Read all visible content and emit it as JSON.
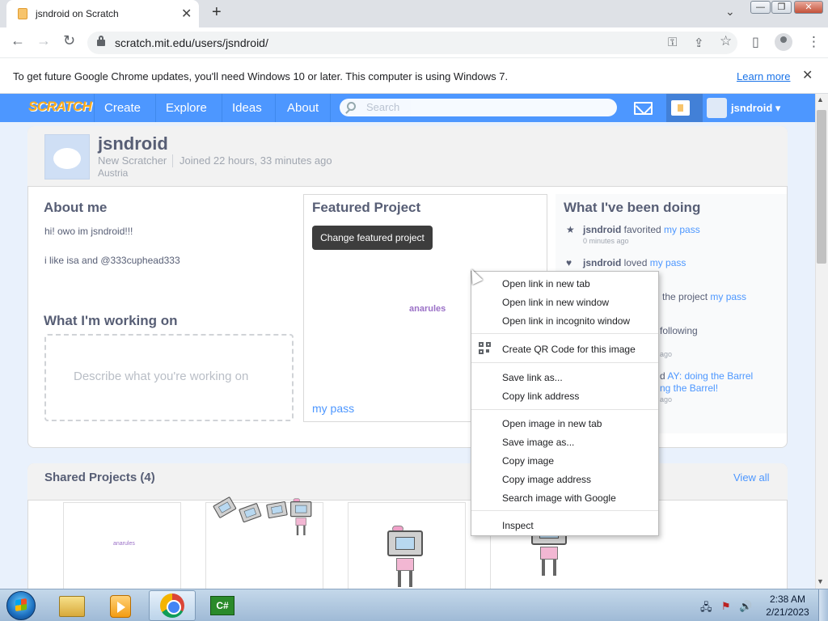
{
  "browser": {
    "tab_title": "jsndroid on Scratch",
    "tab_close": "✕",
    "new_tab": "+",
    "tab_search": "⌄",
    "url": "scratch.mit.edu/users/jsndroid/",
    "window_buttons": {
      "minimize": "—",
      "restore": "❐",
      "close": "✕"
    },
    "nav": {
      "back": "←",
      "forward": "→",
      "reload": "↻"
    },
    "toolbar_icons": {
      "key": "⚿",
      "share": "⇪",
      "bookmark": "☆",
      "sidepanel": "▯",
      "menu": "⋮"
    },
    "infobar": {
      "text": "To get future Google Chrome updates, you'll need Windows 10 or later. This computer is using Windows 7.",
      "learn_more": "Learn more",
      "close": "✕"
    }
  },
  "scratch_nav": {
    "logo": "SCRATCH",
    "items": [
      "Create",
      "Explore",
      "Ideas",
      "About"
    ],
    "search_placeholder": "Search",
    "username": "jsndroid ▾"
  },
  "profile": {
    "name": "jsndroid",
    "status": "New Scratcher",
    "joined": "Joined 22 hours, 33 minutes ago",
    "country": "Austria",
    "about_label": "About me",
    "bio_lines": [
      "hi! owo im jsndroid!!!",
      "i like isa and @333cuphead333"
    ],
    "working_label": "What I'm working on",
    "working_placeholder": "Describe what you're working on",
    "featured_label": "Featured Project",
    "change_featured": "Change featured project",
    "featured_thumb_text": "anarules",
    "featured_title": "my pass",
    "activity_label": "What I've been doing",
    "activity": [
      {
        "icon": "★",
        "user": "jsndroid",
        "verb": " favorited ",
        "link": "my pass",
        "time": "0 minutes ago"
      },
      {
        "icon": "♥",
        "user": "jsndroid",
        "verb": " loved ",
        "link": "my pass",
        "time": ""
      },
      {
        "fragment": "the project ",
        "link": "my pass"
      },
      {
        "fragment": "following",
        "time": "ago"
      },
      {
        "fragment": "d ",
        "link": "AY: doing the Barrel",
        "link2": "ng the Barrel!",
        "time": "ago"
      }
    ]
  },
  "shared": {
    "label": "Shared Projects (4)",
    "view_all": "View all",
    "thumb1_text": "anarules"
  },
  "context_menu": {
    "items": [
      "Open link in new tab",
      "Open link in new window",
      "Open link in incognito window",
      "Create QR Code for this image",
      "Save link as...",
      "Copy link address",
      "Open image in new tab",
      "Save image as...",
      "Copy image",
      "Copy image address",
      "Search image with Google",
      "Inspect"
    ]
  },
  "taskbar": {
    "time": "2:38 AM",
    "date": "2/21/2023",
    "cs_label": "C#",
    "tray": {
      "network": "🖧",
      "flag": "⚑",
      "volume": "🔊"
    }
  }
}
